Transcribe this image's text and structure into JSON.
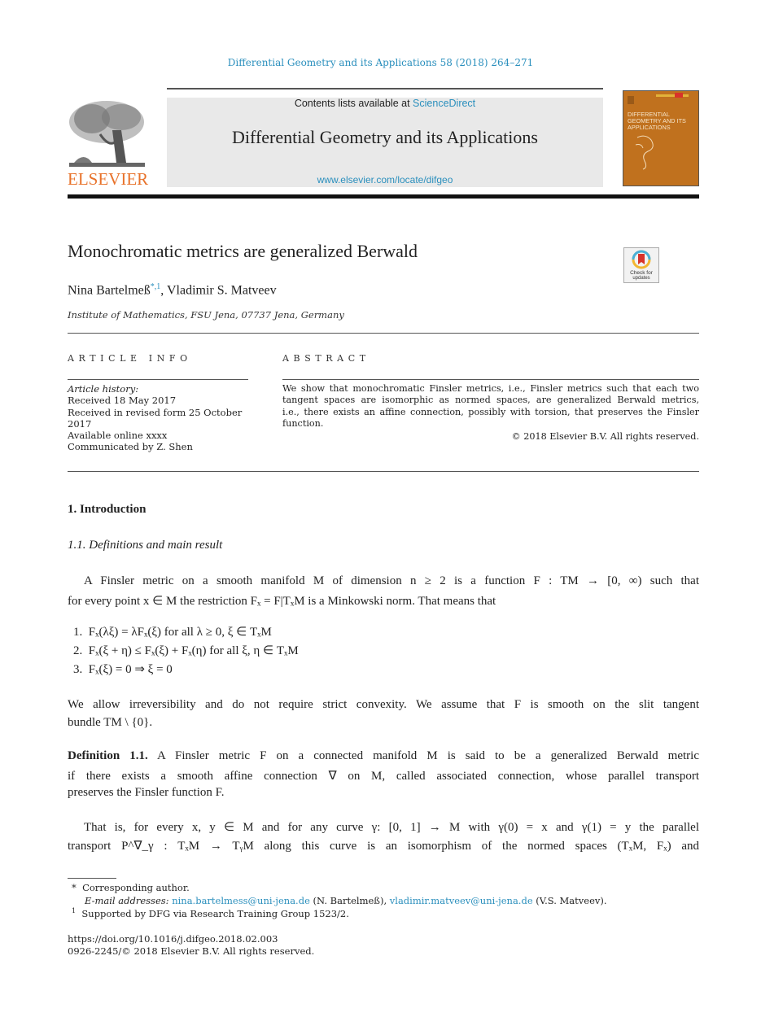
{
  "header": {
    "journal_reference": "Differential Geometry and its Applications 58 (2018) 264–271",
    "contents_prefix": "Contents lists available at ",
    "contents_link": "ScienceDirect",
    "journal_title": "Differential Geometry and its Applications",
    "journal_url": "www.elsevier.com/locate/difgeo",
    "publisher_logo_text": "ELSEVIER",
    "cover_text": "DIFFERENTIAL GEOMETRY AND ITS APPLICATIONS",
    "crossmark_label_1": "Check for",
    "crossmark_label_2": "updates",
    "colors": {
      "link": "#2a8fbd",
      "elsevier_orange": "#e8722a",
      "cover": "#c0711e"
    }
  },
  "article": {
    "title": "Monochromatic metrics are generalized Berwald",
    "author_1": "Nina Bartelmeß",
    "author_1_marks": "*,1",
    "author_separator": ", ",
    "author_2": "Vladimir S. Matveev",
    "affiliation": "Institute of Mathematics, FSU Jena, 07737 Jena, Germany"
  },
  "article_info": {
    "heading": "ARTICLE INFO",
    "history_label": "Article history:",
    "lines": [
      "Received 18 May 2017",
      "Received in revised form 25 October",
      "2017",
      "Available online xxxx",
      "Communicated by Z. Shen"
    ]
  },
  "abstract": {
    "heading": "ABSTRACT",
    "lines": [
      "We show that monochromatic Finsler metrics, i.e., Finsler metrics such that each two",
      "tangent spaces are isomorphic as normed spaces, are generalized Berwald metrics,",
      "i.e., there exists an affine connection, possibly with torsion, that preserves the Finsler",
      "function."
    ],
    "copyright": "© 2018 Elsevier B.V. All rights reserved."
  },
  "body": {
    "section_heading": "1.  Introduction",
    "subsection_heading": "1.1.  Definitions and main result",
    "para1_line1": "A Finsler metric on a smooth manifold M of dimension n ≥ 2 is a function F : TM → [0, ∞) such that",
    "para1_line2": "for every point x ∈ M the restriction Fₓ = F|TₓM is a Minkowski norm. That means that",
    "list": [
      {
        "num": "1.",
        "text": "Fₓ(λξ) = λFₓ(ξ) for all λ ≥ 0, ξ ∈ TₓM"
      },
      {
        "num": "2.",
        "text": "Fₓ(ξ + η) ≤ Fₓ(ξ) + Fₓ(η) for all ξ, η ∈ TₓM"
      },
      {
        "num": "3.",
        "text": "Fₓ(ξ) = 0 ⇒ ξ = 0"
      }
    ],
    "para2_line1": "We allow irreversibility and do not require strict convexity. We assume that F is smooth on the slit tangent",
    "para2_line2": "bundle TM \\ {0}.",
    "definition_label": "Definition 1.1.",
    "definition_line1": " A Finsler metric F on a connected manifold M is said to be a generalized Berwald metric",
    "definition_line2": "if there exists a smooth affine connection ∇ on M, called associated connection, whose parallel transport",
    "definition_line3": "preserves the Finsler function F.",
    "para3_line1": "That is, for every x, y ∈ M and for any curve γ: [0, 1] → M with γ(0) = x and γ(1) = y the parallel",
    "para3_line2": "transport P^∇_γ : TₓM → TᵧM along this curve is an isomorphism of the normed spaces (TₓM, Fₓ) and"
  },
  "footnotes": {
    "star_mark": "*",
    "star_text": "Corresponding author.",
    "email_label": "E-mail addresses:",
    "email_1": "nina.bartelmess@uni-jena.de",
    "email_1_owner": " (N. Bartelmeß), ",
    "email_2": "vladimir.matveev@uni-jena.de",
    "email_2_owner": " (V.S. Matveev).",
    "fn1_mark": "1",
    "fn1_text": "Supported by DFG via Research Training Group 1523/2.",
    "doi": "https://doi.org/10.1016/j.difgeo.2018.02.003",
    "issn_copyright": "0926-2245/© 2018 Elsevier B.V. All rights reserved."
  }
}
